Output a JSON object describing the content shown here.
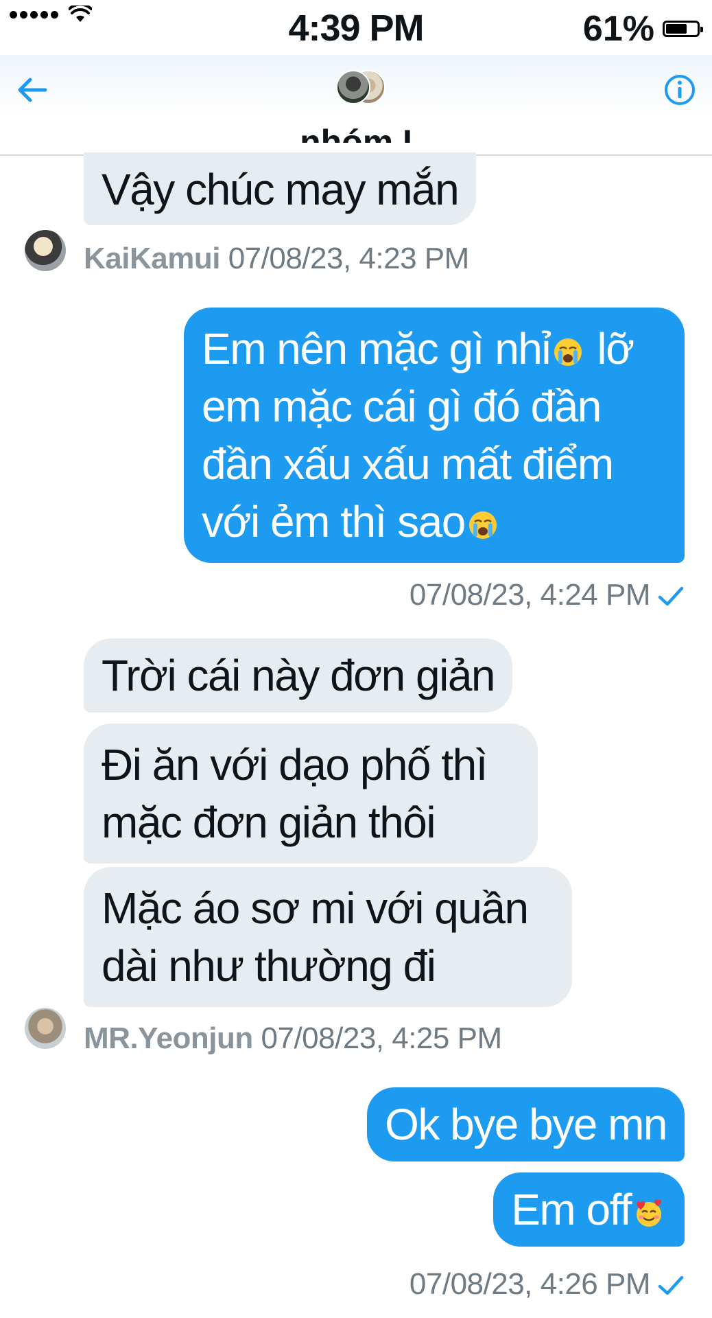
{
  "status_bar": {
    "time": "4:39 PM",
    "battery": "61%"
  },
  "header": {
    "group_name": "nhóm I"
  },
  "messages": [
    {
      "direction": "in",
      "text": "Vậy chúc may mắn"
    },
    {
      "direction": "in_meta",
      "sender": "KaiKamui",
      "timestamp": "07/08/23, 4:23 PM"
    },
    {
      "direction": "out",
      "lines": [
        "Em nên mặc gì nhỉ",
        "lỡ",
        "em mặc cái gì đó đần",
        "đần xấu xấu mất điểm",
        "với ẻm thì sao"
      ]
    },
    {
      "direction": "out_meta",
      "timestamp": "07/08/23, 4:24 PM"
    },
    {
      "direction": "in",
      "text": "Trời cái này đơn giản"
    },
    {
      "direction": "in",
      "lines": [
        "Đi ăn với dạo phố thì",
        "mặc đơn giản thôi"
      ]
    },
    {
      "direction": "in",
      "lines": [
        "Mặc áo sơ mi với quần",
        "dài như thường đi"
      ]
    },
    {
      "direction": "in_meta",
      "sender": "MR.Yeonjun",
      "timestamp": "07/08/23, 4:25 PM"
    },
    {
      "direction": "out",
      "text": "Ok bye bye mn"
    },
    {
      "direction": "out",
      "text": "Em off"
    },
    {
      "direction": "out_meta",
      "timestamp": "07/08/23, 4:26 PM"
    }
  ],
  "icons": {
    "back": "arrow-left-icon",
    "info": "info-icon",
    "crying_emoji": "loudly-crying-face-emoji",
    "love_emoji": "smiling-face-with-hearts-emoji",
    "sent_check": "check-icon"
  },
  "colors": {
    "accent": "#1d9bf0",
    "incoming_bubble": "#e6ecf0",
    "meta_text": "#6e7a84"
  }
}
